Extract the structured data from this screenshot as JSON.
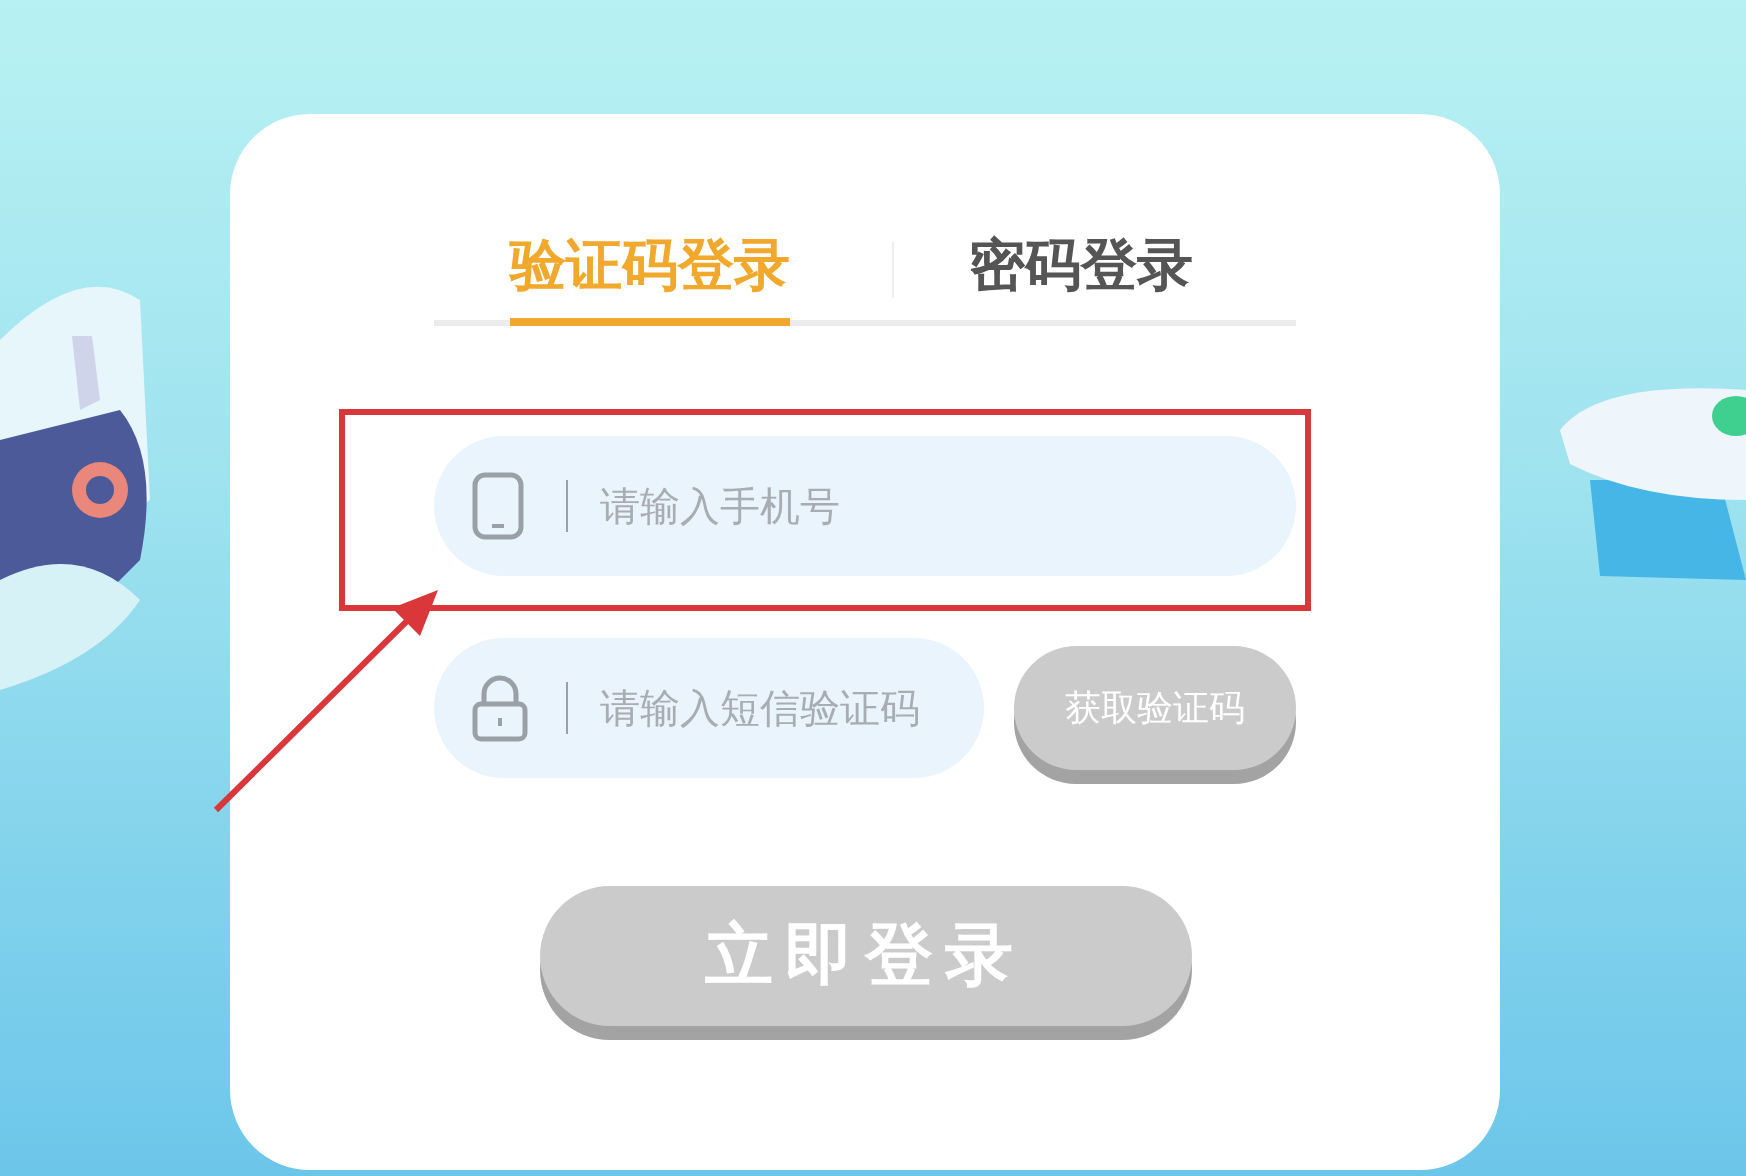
{
  "tabs": [
    {
      "label": "验证码登录",
      "selected": true
    },
    {
      "label": "密码登录",
      "selected": false
    }
  ],
  "fields": [
    {
      "kind": "phone",
      "placeholder": "请输入手机号"
    },
    {
      "kind": "code",
      "placeholder": "请输入短信验证码"
    }
  ],
  "get_code_button": {
    "label": "获取验证码",
    "disabled": true
  },
  "login_button": {
    "label": "立即登录",
    "disabled": true
  }
}
